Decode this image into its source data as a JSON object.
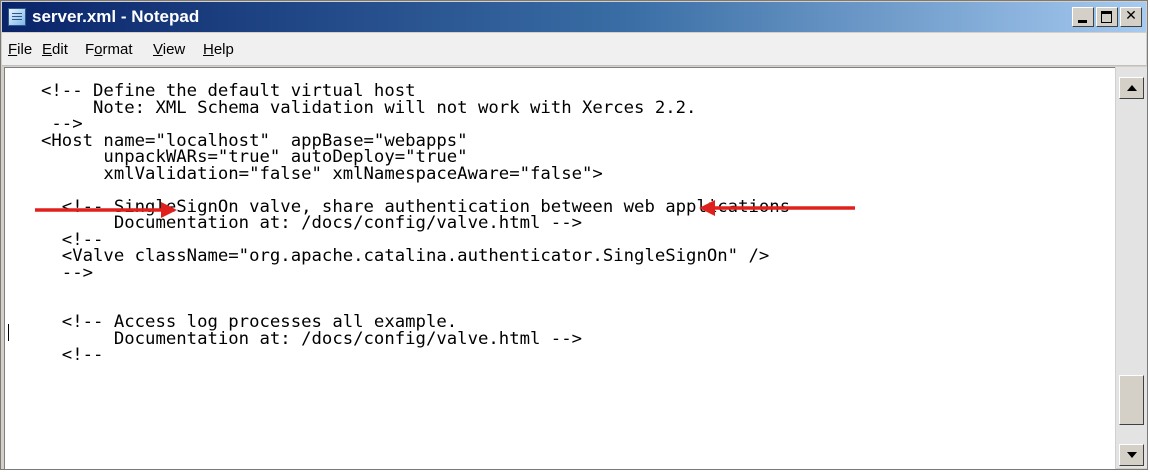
{
  "window": {
    "title": "server.xml - Notepad",
    "controls": {
      "minimize": "",
      "maximize": "",
      "close": "✕"
    }
  },
  "menu": [
    {
      "underline": "F",
      "rest": "ile"
    },
    {
      "underline": "E",
      "rest": "dit"
    },
    {
      "pre": "F",
      "underline": "o",
      "rest": "rmat"
    },
    {
      "underline": "V",
      "rest": "iew"
    },
    {
      "underline": "H",
      "rest": "elp"
    }
  ],
  "editor": {
    "lines": [
      "<!-- Define the default virtual host",
      "     Note: XML Schema validation will not work with Xerces 2.2.",
      " -->",
      "<Host name=\"localhost\"  appBase=\"webapps\"",
      "      unpackWARs=\"true\" autoDeploy=\"true\"",
      "      xmlValidation=\"false\" xmlNamespaceAware=\"false\">",
      "",
      "  <!-- SingleSignOn valve, share authentication between web applications",
      "       Documentation at: /docs/config/valve.html -->",
      "  <!--",
      "  <Valve className=\"org.apache.catalina.authenticator.SingleSignOn\" />",
      "  -->",
      "",
      "",
      "  <!-- Access log processes all example.",
      "       Documentation at: /docs/config/valve.html -->",
      "  <!--"
    ]
  },
  "annotation": {
    "arrow_color": "#e0201c"
  },
  "scrollbar": {
    "position_fraction": 0.86
  }
}
